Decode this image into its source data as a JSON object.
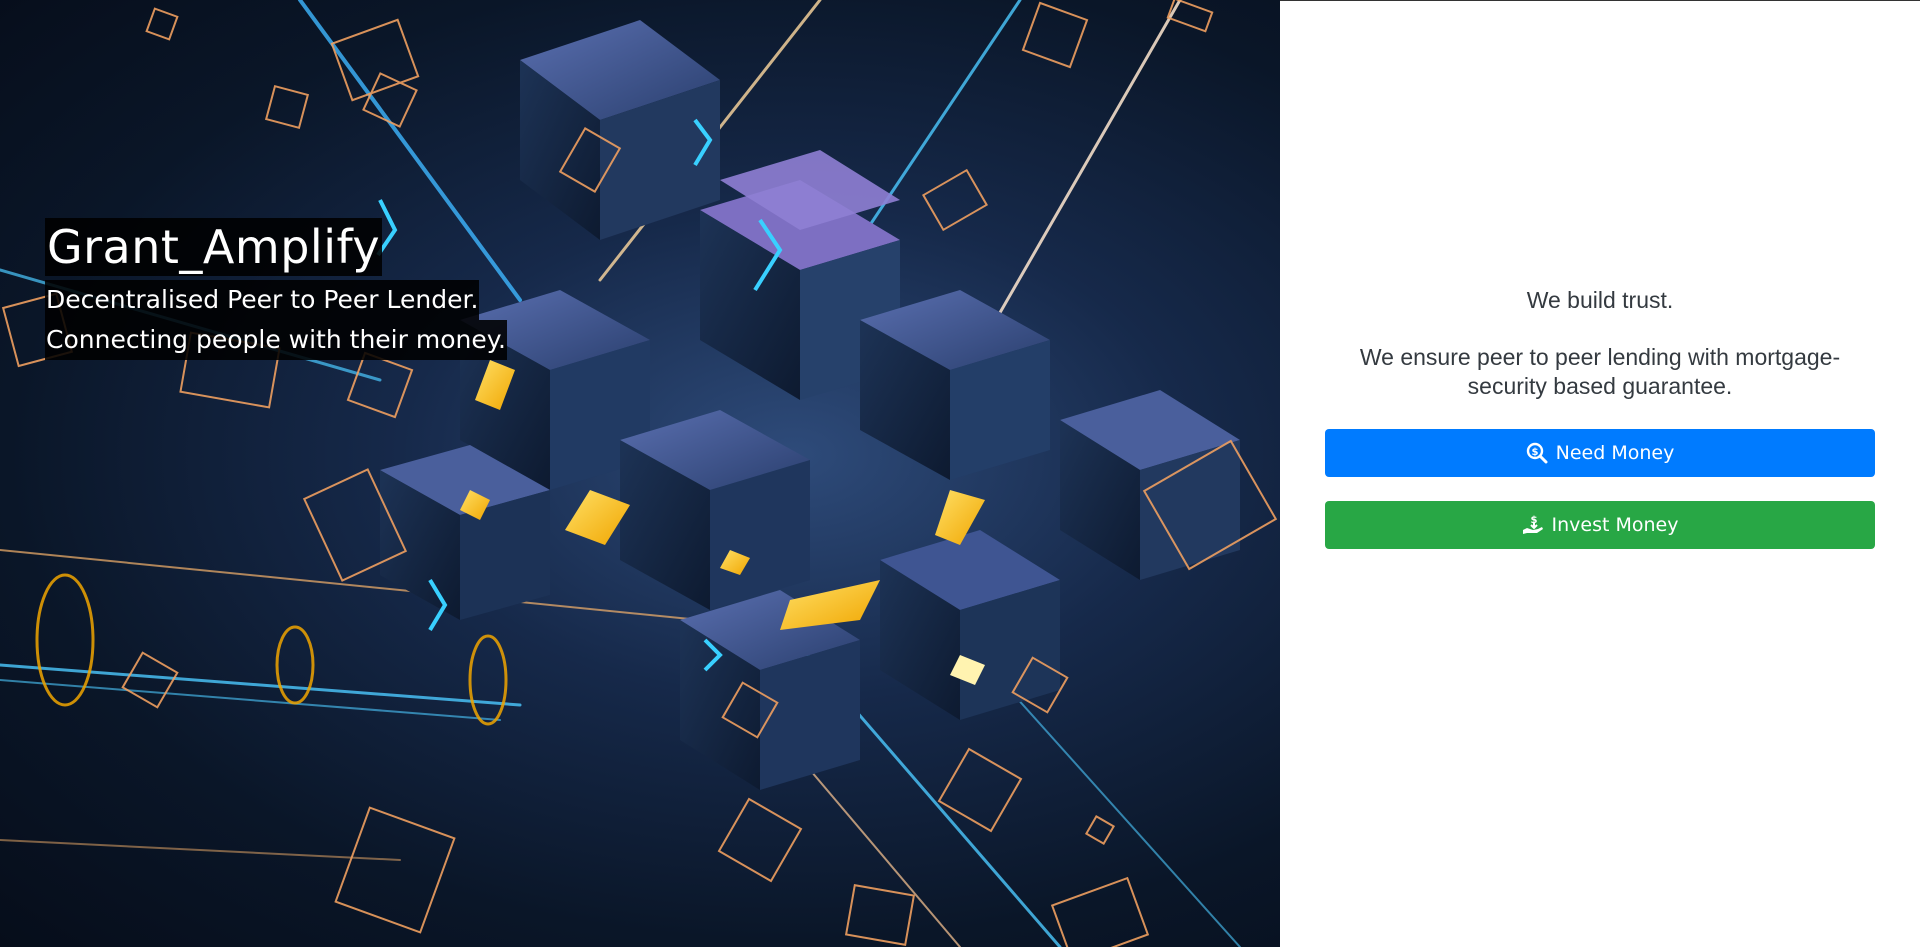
{
  "hero": {
    "title": "Grant_Amplify",
    "subtitle_line1": "Decentralised Peer to Peer Lender.",
    "subtitle_line2": "Connecting people with their money."
  },
  "panel": {
    "tagline_line1": "We build trust.",
    "tagline_line2": "We ensure peer to peer lending with mortgage-security based guarantee.",
    "need_money_label": "Need Money",
    "need_money_icon": "search-dollar-icon",
    "invest_money_label": "Invest Money",
    "invest_money_icon": "hand-holding-money-icon"
  },
  "colors": {
    "primary": "#007bff",
    "success": "#28a745",
    "hero_background": "#0a1628",
    "text": "#343a40"
  }
}
